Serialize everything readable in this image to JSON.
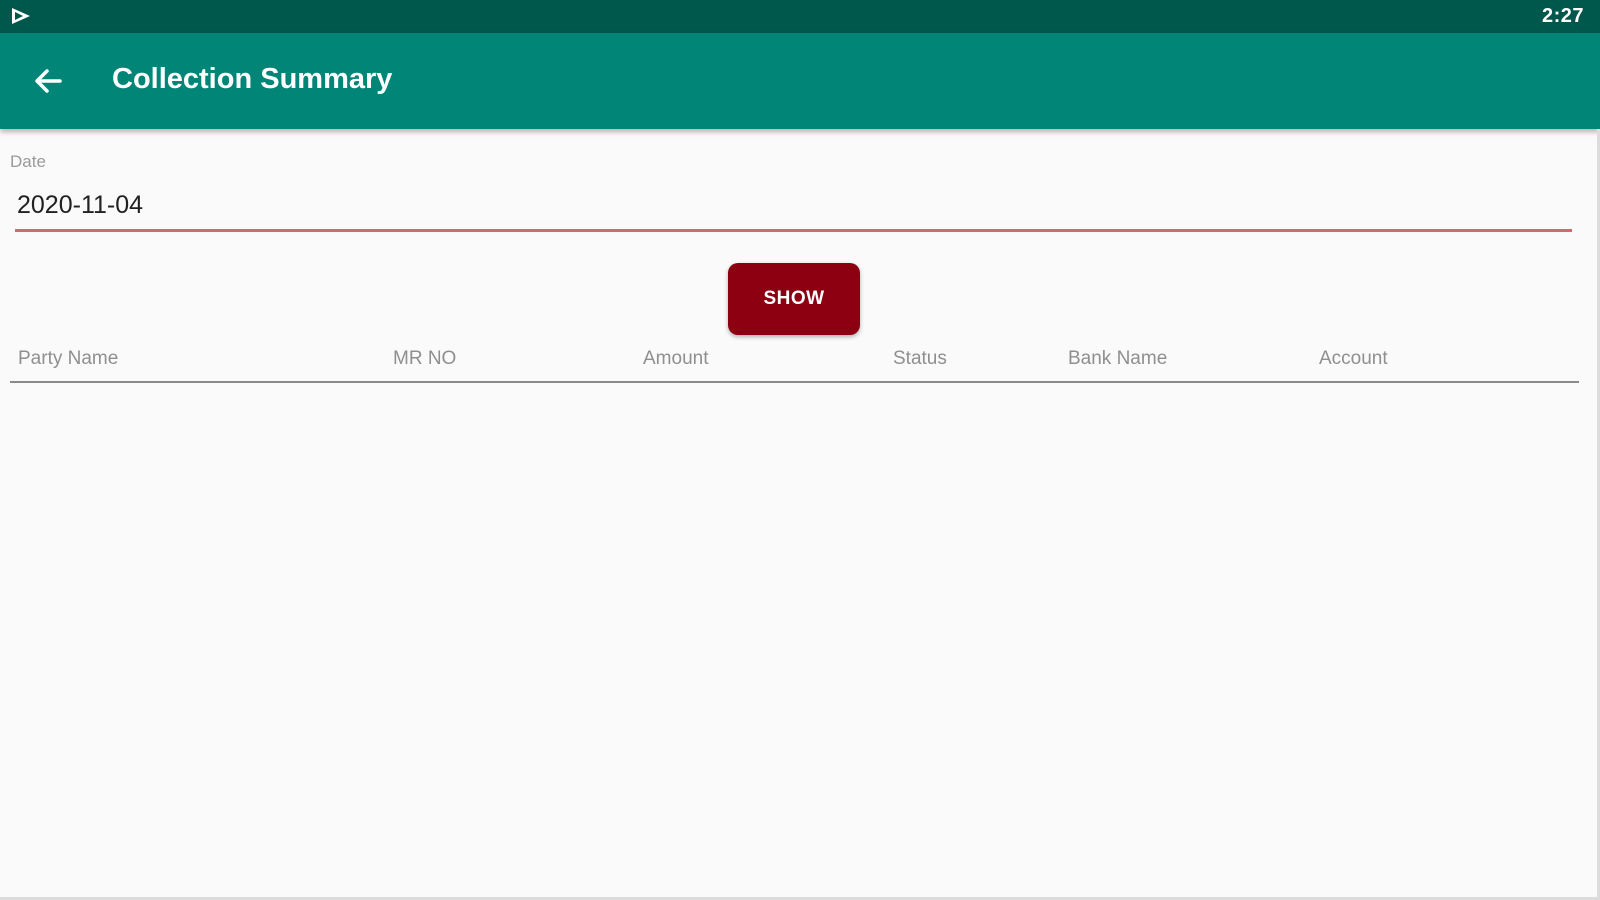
{
  "status_bar": {
    "time": "2:27",
    "notification_icon": "play-store-icon"
  },
  "app_bar": {
    "title": "Collection Summary",
    "back_icon": "back-arrow-icon"
  },
  "form": {
    "date_label": "Date",
    "date_value": "2020-11-04",
    "show_button": "SHOW"
  },
  "table": {
    "columns": [
      "Party Name",
      "MR NO",
      "Amount",
      "Status",
      "Bank Name",
      "Account"
    ],
    "rows": []
  },
  "colors": {
    "status_bar": "#00574b",
    "app_bar": "#008577",
    "button": "#8d0012",
    "input_underline": "#d06a6f"
  }
}
